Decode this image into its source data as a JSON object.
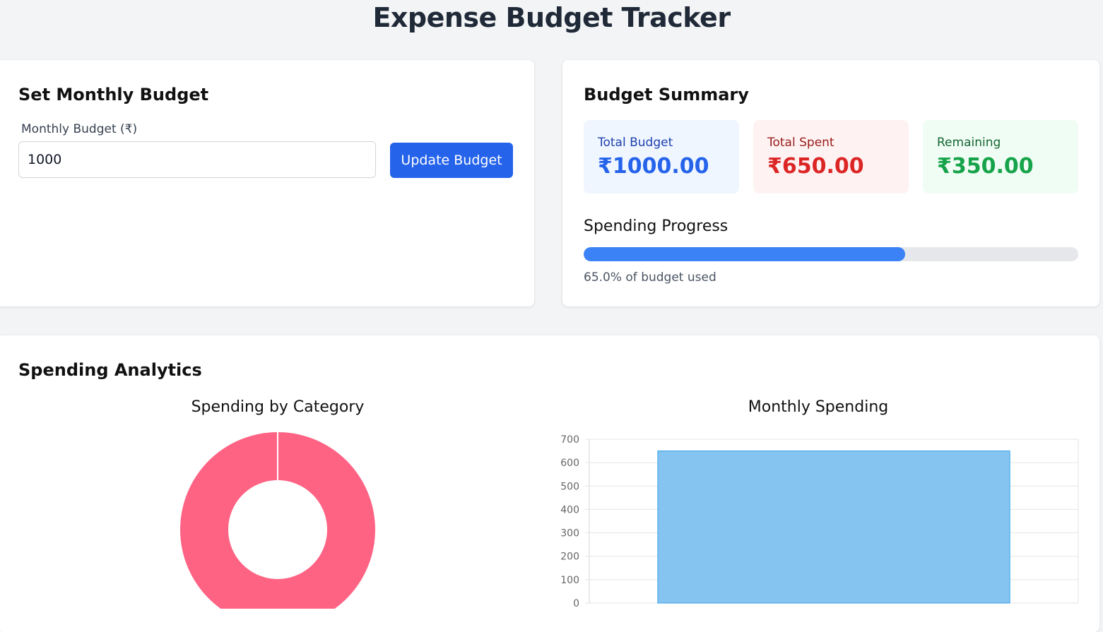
{
  "page": {
    "title": "Expense Budget Tracker"
  },
  "budget_form": {
    "heading": "Set Monthly Budget",
    "label": "Monthly Budget (₹)",
    "value": "1000",
    "button": "Update Budget"
  },
  "summary": {
    "heading": "Budget Summary",
    "total_budget": {
      "label": "Total Budget",
      "value": "₹1000.00"
    },
    "total_spent": {
      "label": "Total Spent",
      "value": "₹650.00"
    },
    "remaining": {
      "label": "Remaining",
      "value": "₹350.00"
    },
    "progress": {
      "title": "Spending Progress",
      "percent": 65.0,
      "text": "65.0% of budget used"
    }
  },
  "analytics": {
    "heading": "Spending Analytics",
    "category_chart_title": "Spending by Category",
    "monthly_chart_title": "Monthly Spending"
  },
  "colors": {
    "primary": "#2563eb",
    "progress": "#3b82f6",
    "donut": "#ff6384",
    "bar_fill": "#85c4f0",
    "bar_stroke": "#36a2eb"
  },
  "chart_data": [
    {
      "type": "pie",
      "variant": "doughnut",
      "title": "Spending by Category",
      "series": [
        {
          "values": [
            650
          ]
        }
      ]
    },
    {
      "type": "bar",
      "title": "Monthly Spending",
      "series": [
        {
          "values": [
            650
          ]
        }
      ],
      "ylim": [
        0,
        700
      ],
      "yticks": [
        0,
        100,
        200,
        300,
        400,
        500,
        600,
        700
      ],
      "grid": true
    }
  ]
}
